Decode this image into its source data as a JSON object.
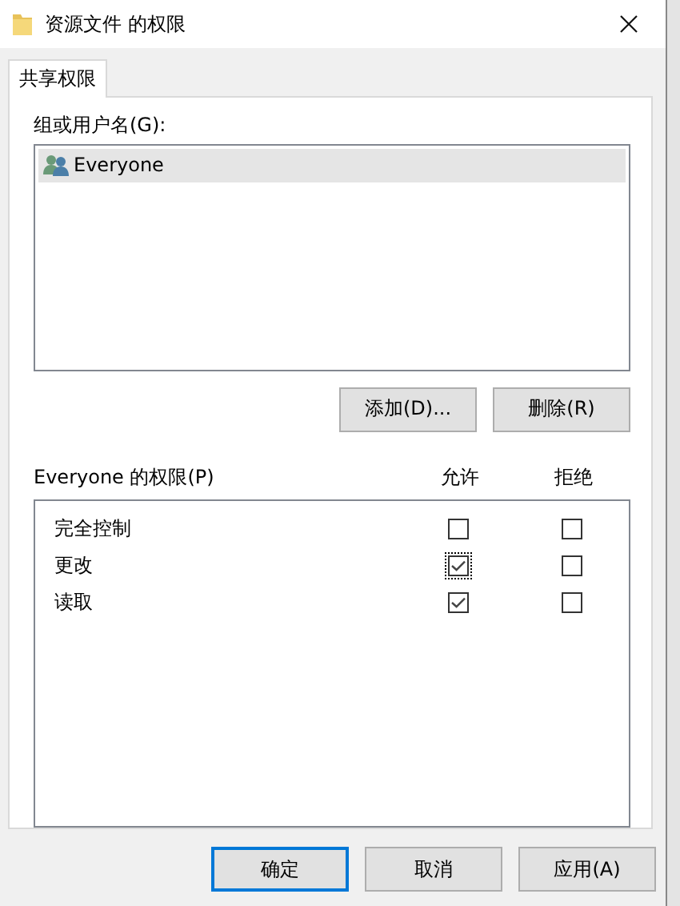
{
  "window": {
    "title": "资源文件 的权限"
  },
  "tabs": [
    {
      "label": "共享权限",
      "selected": true
    }
  ],
  "groups": {
    "label": "组或用户名(G):",
    "items": [
      {
        "name": "Everyone",
        "selected": true
      }
    ]
  },
  "group_buttons": [
    "添加(D)...",
    "删除(R)"
  ],
  "permissions": {
    "label": "Everyone 的权限(P)",
    "columns": [
      "允许",
      "拒绝"
    ],
    "rows": [
      {
        "name": "完全控制",
        "allow": false,
        "allow_focused": false,
        "deny": false
      },
      {
        "name": "更改",
        "allow": true,
        "allow_focused": true,
        "deny": false
      },
      {
        "name": "读取",
        "allow": true,
        "allow_focused": false,
        "deny": false
      }
    ]
  },
  "buttons": [
    {
      "label": "确定",
      "default": true
    },
    {
      "label": "取消",
      "default": false
    },
    {
      "label": "应用(A)",
      "default": false
    }
  ]
}
